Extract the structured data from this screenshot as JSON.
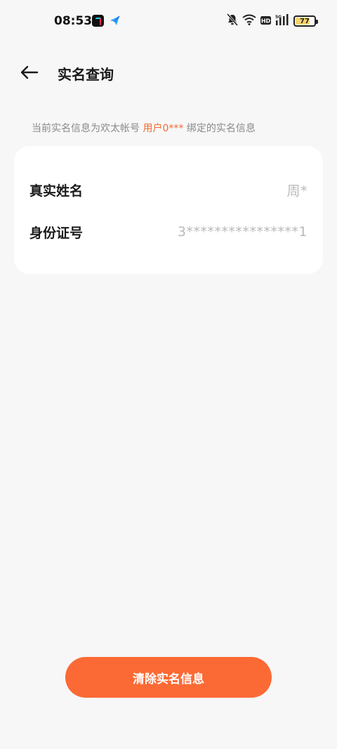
{
  "status_bar": {
    "time": "08:53",
    "battery_level": "77",
    "battery_fraction": 0.77
  },
  "header": {
    "title": "实名查询"
  },
  "info": {
    "prefix": "当前实名信息为欢太帐号",
    "account": "用户0***",
    "suffix": "绑定的实名信息"
  },
  "card": {
    "rows": [
      {
        "label": "真实姓名",
        "value": "周*"
      },
      {
        "label": "身份证号",
        "value": "3****************1"
      }
    ]
  },
  "actions": {
    "clear_label": "清除实名信息"
  },
  "colors": {
    "accent": "#fb6a35",
    "highlight": "#f26a35",
    "background": "#f7f7f7",
    "card": "#ffffff"
  },
  "icons": [
    "back-arrow-icon",
    "tiktok-icon",
    "send-icon",
    "mute-icon",
    "wifi-icon",
    "hd-icon",
    "signal-icon",
    "battery-icon"
  ]
}
